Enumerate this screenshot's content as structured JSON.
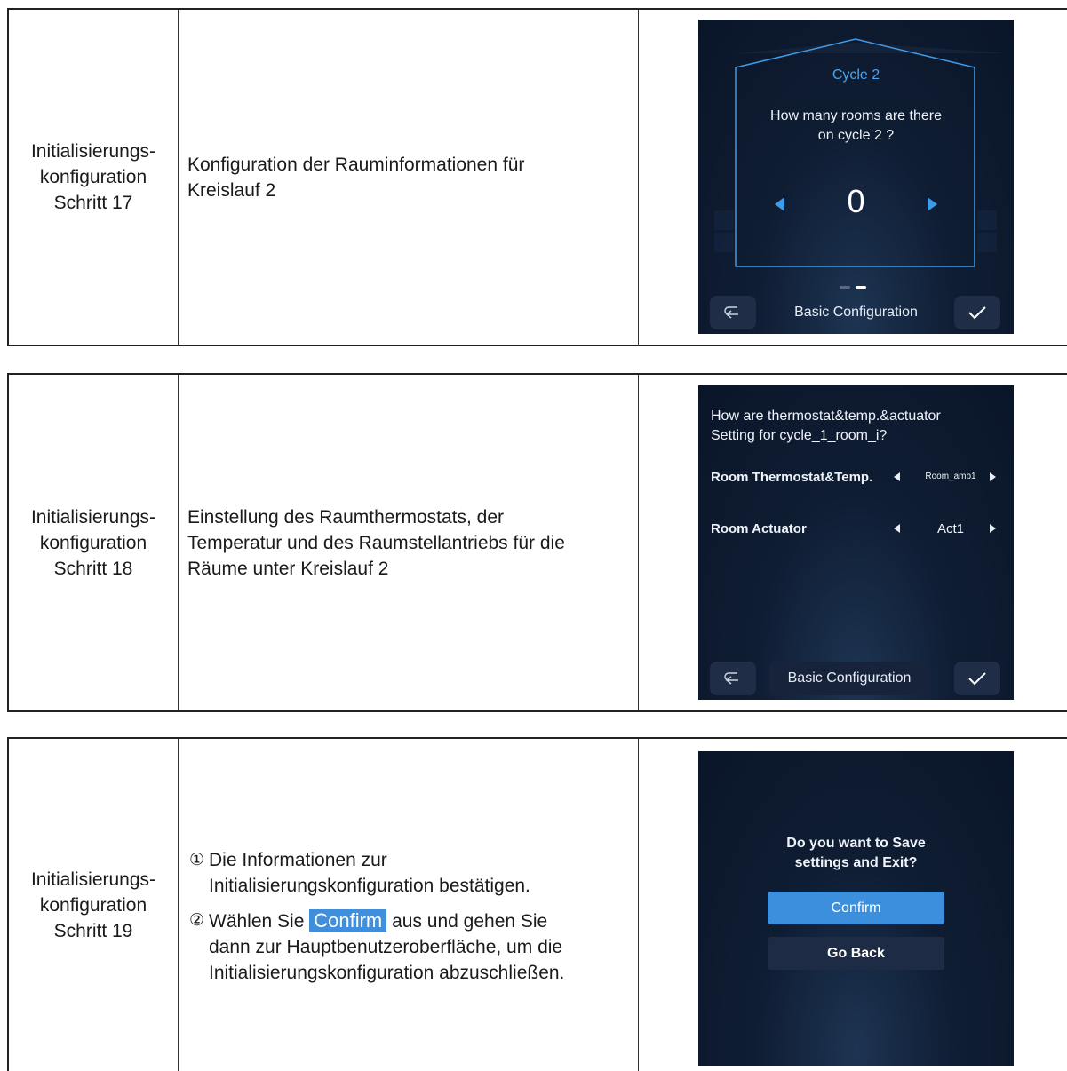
{
  "rows": [
    {
      "step": [
        "Initialisierungs-",
        "konfiguration",
        "Schritt 17"
      ],
      "description": [
        "Konfiguration der Rauminformationen für",
        "Kreislauf 2"
      ],
      "screen": {
        "title": "Cycle 2",
        "question": [
          "How many rooms are there",
          "on cycle 2 ?"
        ],
        "value": "0",
        "bar_label": "Basic Configuration"
      }
    },
    {
      "step": [
        "Initialisierungs-",
        "konfiguration",
        "Schritt 18"
      ],
      "description": [
        "Einstellung des Raumthermostats, der",
        "Temperatur und des Raumstellantriebs für die",
        "Räume unter Kreislauf 2"
      ],
      "screen": {
        "question": [
          "How are  thermostat&temp.&actuator",
          "Setting for cycle_1_room_i?"
        ],
        "settings": [
          {
            "label": "Room Thermostat&Temp.",
            "value": "Room_amb1"
          },
          {
            "label": "Room Actuator",
            "value": "Act1"
          }
        ],
        "bar_label": "Basic Configuration"
      }
    },
    {
      "step": [
        "Initialisierungs-",
        "konfiguration",
        "Schritt 19"
      ],
      "steps": [
        {
          "num": "①",
          "lines": [
            "Die Informationen zur",
            "Initialisierungskonfiguration bestätigen."
          ]
        },
        {
          "num": "②",
          "before": "Wählen Sie",
          "highlight": "Confirm",
          "after": "aus und gehen Sie",
          "lines": [
            "dann zur Hauptbenutzeroberfläche, um die",
            "Initialisierungskonfiguration abzuschließen."
          ]
        }
      ],
      "screen": {
        "question": [
          "Do you want to Save",
          "settings and Exit?"
        ],
        "confirm": "Confirm",
        "back": "Go Back"
      }
    }
  ],
  "colors": {
    "accent": "#3b8fdc",
    "screen_bg": "#0f1d33",
    "button_dark": "#1e2b45"
  }
}
